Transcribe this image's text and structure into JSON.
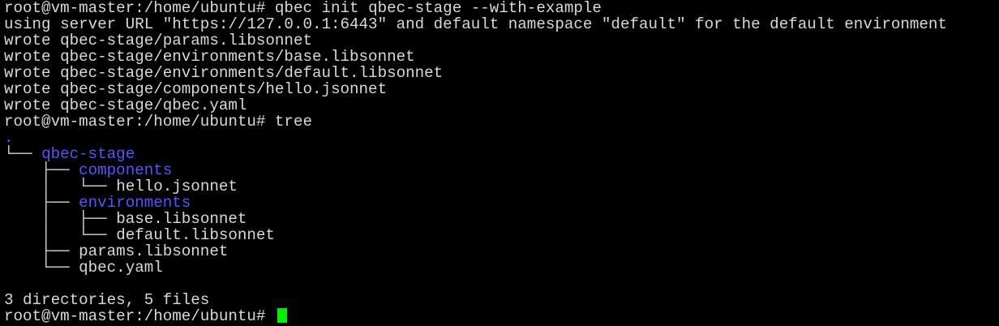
{
  "terminal": {
    "lines": [
      {
        "prompt": "root@vm-master:/home/ubuntu# ",
        "command": "qbec init qbec-stage --with-example"
      },
      {
        "text": "using server URL \"https://127.0.0.1:6443\" and default namespace \"default\" for the default environment"
      },
      {
        "text": "wrote qbec-stage/params.libsonnet"
      },
      {
        "text": "wrote qbec-stage/environments/base.libsonnet"
      },
      {
        "text": "wrote qbec-stage/environments/default.libsonnet"
      },
      {
        "text": "wrote qbec-stage/components/hello.jsonnet"
      },
      {
        "text": "wrote qbec-stage/qbec.yaml"
      },
      {
        "prompt": "root@vm-master:/home/ubuntu# ",
        "command": "tree"
      }
    ],
    "tree": {
      "root": ".",
      "entries": [
        {
          "branch": "└── ",
          "name": "qbec-stage",
          "type": "dir"
        },
        {
          "branch": "    ├── ",
          "name": "components",
          "type": "dir"
        },
        {
          "branch": "    │   └── ",
          "name": "hello.jsonnet",
          "type": "file"
        },
        {
          "branch": "    ├── ",
          "name": "environments",
          "type": "dir"
        },
        {
          "branch": "    │   ├── ",
          "name": "base.libsonnet",
          "type": "file"
        },
        {
          "branch": "    │   └── ",
          "name": "default.libsonnet",
          "type": "file"
        },
        {
          "branch": "    ├── ",
          "name": "params.libsonnet",
          "type": "file"
        },
        {
          "branch": "    └── ",
          "name": "qbec.yaml",
          "type": "file"
        }
      ],
      "summary": "3 directories, 5 files"
    },
    "final_prompt": "root@vm-master:/home/ubuntu# "
  },
  "colors": {
    "background": "#000000",
    "text": "#d8d8d8",
    "directory": "#5555ff",
    "cursor": "#00ee00"
  }
}
